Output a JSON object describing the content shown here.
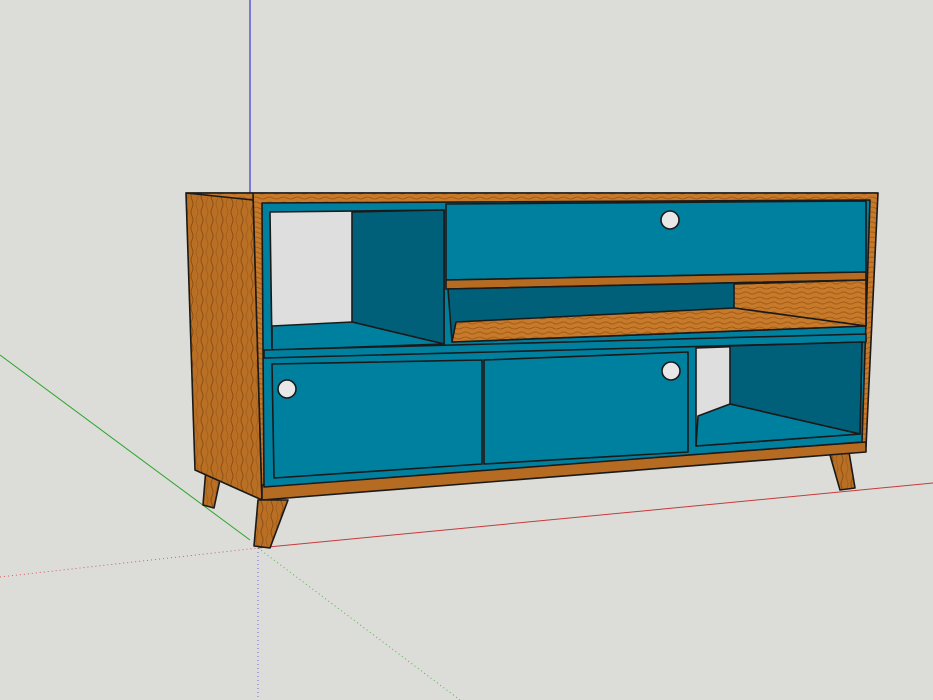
{
  "scene": {
    "background_color": "#dcdcd9",
    "axis_colors": {
      "blue_axis": "#3a3ad0",
      "green_axis": "#2aa62a",
      "red_axis": "#c83a3a"
    },
    "colors": {
      "wood": "#c77a2a",
      "wood_dark": "#a8611c",
      "wood_grain": "#8e4f14",
      "teal_panel": "#00809f",
      "teal_dark": "#00607a",
      "teal_deep": "#004f66",
      "hole": "#e8e8e8",
      "edge": "#1a1a1a"
    },
    "model": {
      "object": "tv-stand-cabinet",
      "doors": [
        "top-drawer-with-hole",
        "left-sliding-door-with-hole",
        "right-sliding-door-with-hole"
      ],
      "compartments": [
        "open-left-cubby",
        "open-middle-shelf",
        "open-right-cubby"
      ]
    }
  }
}
